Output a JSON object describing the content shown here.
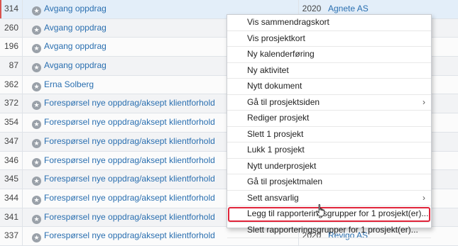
{
  "rows": [
    {
      "id": "314",
      "title": "Avgang oppdrag",
      "year": "2020",
      "client": "Agnete AS",
      "selected": true
    },
    {
      "id": "260",
      "title": "Avgang oppdrag",
      "year": "",
      "client": ""
    },
    {
      "id": "196",
      "title": "Avgang oppdrag",
      "year": "",
      "client": ""
    },
    {
      "id": "87",
      "title": "Avgang oppdrag",
      "year": "",
      "client": ""
    },
    {
      "id": "362",
      "title": "Erna Solberg",
      "year": "",
      "client": ""
    },
    {
      "id": "372",
      "title": "Forespørsel nye oppdrag/aksept klientforhold",
      "year": "",
      "client": ""
    },
    {
      "id": "354",
      "title": "Forespørsel nye oppdrag/aksept klientforhold",
      "year": "",
      "client": ""
    },
    {
      "id": "347",
      "title": "Forespørsel nye oppdrag/aksept klientforhold",
      "year": "",
      "client": ""
    },
    {
      "id": "346",
      "title": "Forespørsel nye oppdrag/aksept klientforhold",
      "year": "",
      "client": ""
    },
    {
      "id": "345",
      "title": "Forespørsel nye oppdrag/aksept klientforhold",
      "year": "",
      "client": ""
    },
    {
      "id": "344",
      "title": "Forespørsel nye oppdrag/aksept klientforhold",
      "year": "",
      "client": ""
    },
    {
      "id": "341",
      "title": "Forespørsel nye oppdrag/aksept klientforhold",
      "year": "",
      "client": ""
    },
    {
      "id": "337",
      "title": "Forespørsel nye oppdrag/aksept klientforhold",
      "year": "2020",
      "client": "Revigo AS"
    }
  ],
  "context_menu": {
    "items": [
      {
        "label": "Vis sammendragskort"
      },
      {
        "label": "Vis prosjektkort"
      },
      {
        "label": "Ny kalenderføring"
      },
      {
        "label": "Ny aktivitet"
      },
      {
        "label": "Nytt dokument"
      },
      {
        "label": "Gå til prosjektsiden",
        "submenu": true
      },
      {
        "label": "Rediger prosjekt"
      },
      {
        "label": "Slett 1 prosjekt"
      },
      {
        "label": "Lukk 1 prosjekt"
      },
      {
        "label": "Nytt underprosjekt"
      },
      {
        "label": "Gå til prosjektmalen"
      },
      {
        "label": "Sett ansvarlig",
        "submenu": true
      },
      {
        "label": "Legg til rapporteringsgrupper for 1 prosjekt(er)...",
        "highlighted": true
      },
      {
        "label": "Slett rapporteringsgrupper for 1 prosjekt(er)..."
      }
    ],
    "submenu_glyph": "›"
  },
  "icons": {
    "row_icon": "star-icon",
    "cursor": "hand-pointer-icon"
  },
  "colors": {
    "link": "#2a6fb0",
    "highlight_outline": "#e0243a",
    "selected_row": "#e3eef9"
  }
}
